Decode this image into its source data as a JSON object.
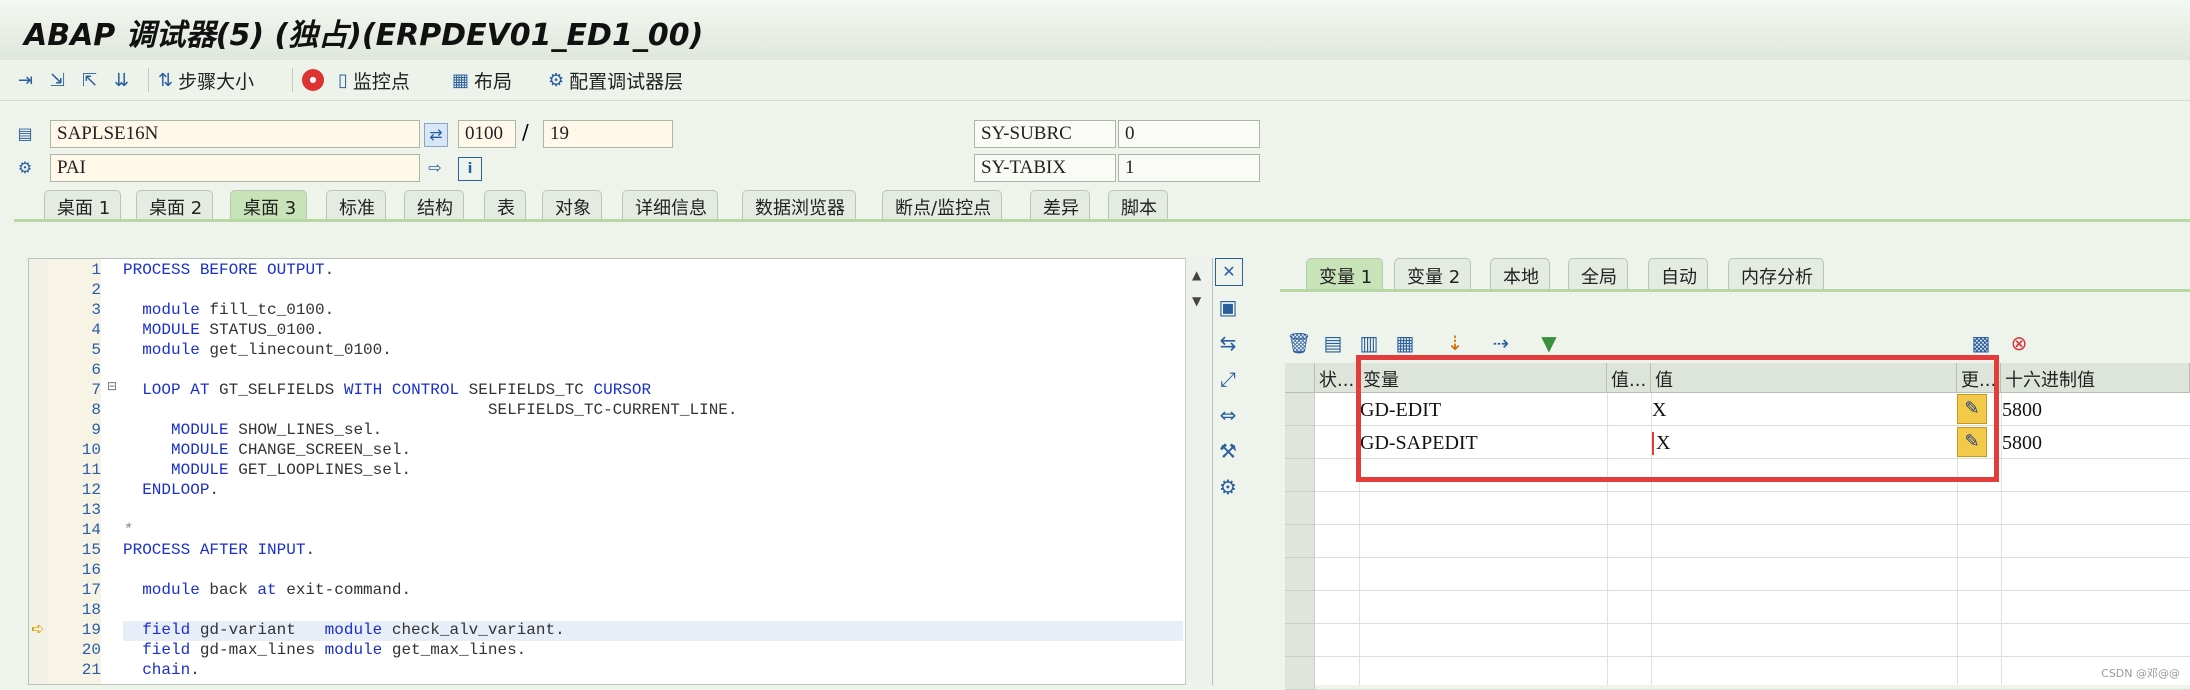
{
  "window": {
    "title": "ABAP 调试器(5) (独占)(ERPDEV01_ED1_00)"
  },
  "toolbar": {
    "step_size": "步骤大小",
    "watchpoint": "监控点",
    "layout": "布局",
    "config_layers": "配置调试器层"
  },
  "info": {
    "program": "SAPLSE16N",
    "event": "PAI",
    "screen": "0100",
    "slash": "/",
    "line": "19",
    "subrc_label": "SY-SUBRC",
    "subrc_value": "0",
    "tabix_label": "SY-TABIX",
    "tabix_value": "1"
  },
  "main_tabs": [
    "桌面 1",
    "桌面 2",
    "桌面 3",
    "标准",
    "结构",
    "表",
    "对象",
    "详细信息",
    "数据浏览器",
    "断点/监控点",
    "差异",
    "脚本"
  ],
  "active_main_tab": "桌面 3",
  "code": {
    "line_numbers": [
      "1",
      "2",
      "3",
      "4",
      "5",
      "6",
      "7",
      "8",
      "9",
      "10",
      "11",
      "12",
      "13",
      "14",
      "15",
      "16",
      "17",
      "18",
      "19",
      "20",
      "21"
    ],
    "lines": [
      "PROCESS BEFORE OUTPUT.",
      "",
      "  module fill_tc_0100.",
      "  MODULE STATUS_0100.",
      "  module get_linecount_0100.",
      "",
      "  LOOP AT GT_SELFIELDS WITH CONTROL SELFIELDS_TC CURSOR",
      "                                      SELFIELDS_TC-CURRENT_LINE.",
      "     MODULE SHOW_LINES_sel.",
      "     MODULE CHANGE_SCREEN_sel.",
      "     MODULE GET_LOOPLINES_sel.",
      "  ENDLOOP.",
      "",
      "*",
      "PROCESS AFTER INPUT.",
      "",
      "  module back at exit-command.",
      "",
      "  field gd-variant   module check_alv_variant.",
      "  field gd-max_lines module get_max_lines.",
      "  chain."
    ],
    "current_line": "19",
    "collapse_marker": "⊟"
  },
  "var_tabs": [
    "变量 1",
    "变量 2",
    "本地",
    "全局",
    "自动",
    "内存分析"
  ],
  "active_var_tab": "变量 1",
  "grid": {
    "headers": [
      "状...",
      "变量",
      "值...",
      "值",
      "更...",
      "十六进制值"
    ],
    "rows": [
      {
        "variable": "GD-EDIT",
        "value": "X",
        "hex": "5800"
      },
      {
        "variable": "GD-SAPEDIT",
        "value": "X",
        "hex": "5800"
      }
    ]
  },
  "watermark": "CSDN @邓@@",
  "colors": {
    "highlight": "#e43b3b",
    "active_tab": "#c9e3b8",
    "keyword": "#1a2fd0"
  }
}
